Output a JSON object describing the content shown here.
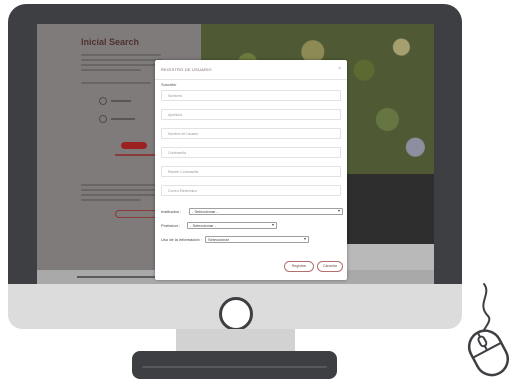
{
  "modal": {
    "title": "REGISTRO DE USUARIO",
    "close_icon": "×",
    "subtitle": "Suscribir",
    "fields": [
      {
        "placeholder": "Nombres"
      },
      {
        "placeholder": "Apellidos"
      },
      {
        "placeholder": "Nombre de Usuario"
      },
      {
        "placeholder": "Contraseña"
      },
      {
        "placeholder": "Repetir Contraseña"
      },
      {
        "placeholder": "Correo Electrónico"
      }
    ],
    "institucion": {
      "label": "Institución :",
      "value": "- Seleccionar -"
    },
    "profesion": {
      "label": "Profesion :",
      "value": "- Seleccionar -"
    },
    "uso": {
      "label": "Uso de la información :",
      "value": "Seleccionar"
    },
    "buttons": {
      "register": "Registrar",
      "cancel": "Cancelar"
    }
  },
  "site": {
    "heading": "Inicial Search"
  },
  "colors": {
    "monitor": "#3d3f42",
    "chin": "#dcdcdc",
    "accent": "#9b2220"
  },
  "icons": {
    "power": "power-button-icon",
    "mouse": "mouse-icon"
  }
}
